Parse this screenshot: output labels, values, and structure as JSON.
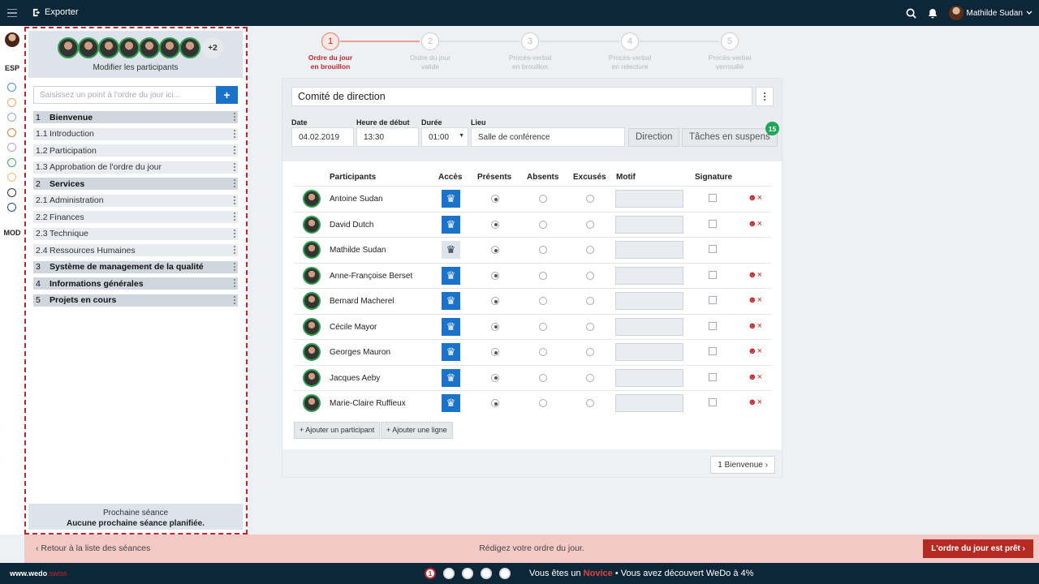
{
  "topbar": {
    "export_label": "Exporter",
    "user_name": "Mathilde Sudan"
  },
  "rail": {
    "esp_label": "ESP",
    "mod_label": "MOD",
    "dot_colors": [
      "#4a90d9",
      "#e8a867",
      "#9aa7b3",
      "#d8803b",
      "#b59fcf",
      "#4aa564",
      "#e8c06b",
      "#333333",
      "#1e4e75"
    ]
  },
  "left_panel": {
    "avatar_more": "+2",
    "modify_participants": "Modifier les participants",
    "input_placeholder": "Saisissez un point à l'ordre du jour ici...",
    "add_button": "+",
    "agenda": [
      {
        "num": "1",
        "label": "Bienvenue",
        "main": true
      },
      {
        "num": "1.1",
        "label": "Introduction",
        "main": false
      },
      {
        "num": "1.2",
        "label": "Participation",
        "main": false
      },
      {
        "num": "1.3",
        "label": "Approbation de l'ordre du jour",
        "main": false
      },
      {
        "num": "2",
        "label": "Services",
        "main": true
      },
      {
        "num": "2.1",
        "label": "Administration",
        "main": false
      },
      {
        "num": "2.2",
        "label": "Finances",
        "main": false
      },
      {
        "num": "2.3",
        "label": "Technique",
        "main": false
      },
      {
        "num": "2.4",
        "label": "Ressources Humaines",
        "main": false
      },
      {
        "num": "3",
        "label": "Système de management de la qualité",
        "main": true
      },
      {
        "num": "4",
        "label": "Informations générales",
        "main": true
      },
      {
        "num": "5",
        "label": "Projets en cours",
        "main": true
      }
    ],
    "next_session_label": "Prochaine séance",
    "next_session_value": "Aucune prochaine séance planifiée."
  },
  "stepper": [
    {
      "num": "1",
      "line1": "Ordre du jour",
      "line2": "en brouillon",
      "active": true
    },
    {
      "num": "2",
      "line1": "Ordre du jour",
      "line2": "validé",
      "active": false
    },
    {
      "num": "3",
      "line1": "Procès-verbal",
      "line2": "en brouillon",
      "active": false
    },
    {
      "num": "4",
      "line1": "Procès-verbal",
      "line2": "en relecture",
      "active": false
    },
    {
      "num": "5",
      "line1": "Procès-verbal",
      "line2": "verrouillé",
      "active": false
    }
  ],
  "meeting": {
    "title": "Comité de direction",
    "date_label": "Date",
    "date": "04.02.2019",
    "start_label": "Heure de début",
    "start": "13:30",
    "duration_label": "Durée",
    "duration": "01:00",
    "place_label": "Lieu",
    "place": "Salle de conférence",
    "direction_button": "Direction",
    "pending_tasks_button": "Tâches en suspens",
    "pending_count": "15"
  },
  "table": {
    "headers": {
      "participants": "Participants",
      "access": "Accès",
      "present": "Présents",
      "absent": "Absents",
      "excused": "Excusés",
      "motif": "Motif",
      "signature": "Signature"
    },
    "rows": [
      {
        "name": "Antoine Sudan",
        "access": true,
        "present": true,
        "removable": true
      },
      {
        "name": "David Dutch",
        "access": true,
        "present": true,
        "removable": true
      },
      {
        "name": "Mathilde Sudan",
        "access": false,
        "present": true,
        "removable": false
      },
      {
        "name": "Anne-Françoise Berset",
        "access": true,
        "present": true,
        "removable": true
      },
      {
        "name": "Bernard Macherel",
        "access": true,
        "present": true,
        "removable": true
      },
      {
        "name": "Cécile Mayor",
        "access": true,
        "present": true,
        "removable": true
      },
      {
        "name": "Georges Mauron",
        "access": true,
        "present": true,
        "removable": true
      },
      {
        "name": "Jacques Aeby",
        "access": true,
        "present": true,
        "removable": true
      },
      {
        "name": "Marie-Claire Ruffieux",
        "access": true,
        "present": true,
        "removable": true
      }
    ],
    "add_participant": "+ Ajouter un participant",
    "add_line": "+ Ajouter une ligne",
    "next_item": "1 Bienvenue"
  },
  "pinkbar": {
    "back": "Retour à la liste des séances",
    "message": "Rédigez votre ordre du jour.",
    "ready_button": "L'ordre du jour est prêt"
  },
  "footer": {
    "site_main": "www.wedo",
    "site_tld": ".swiss",
    "progress_first": "1",
    "msg_prefix": "Vous êtes un",
    "level": "Novice",
    "msg_suffix": "• Vous avez découvert WeDo à 4%"
  }
}
